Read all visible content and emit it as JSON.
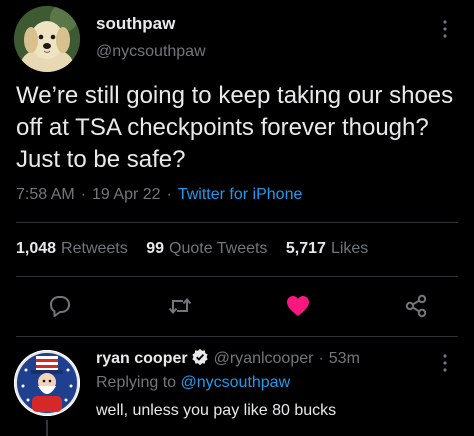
{
  "author": {
    "name": "southpaw",
    "handle": "@nycsouthpaw",
    "avatar": "golden-retriever-puppy"
  },
  "tweet": {
    "text": "We’re still going to keep taking our shoes off at TSA checkpoints forever though? Just to be safe?",
    "time": "7:58 AM",
    "date": "19 Apr 22",
    "source": "Twitter for iPhone"
  },
  "stats": {
    "retweets_count": "1,048",
    "retweets_label": "Retweets",
    "quotes_count": "99",
    "quotes_label": "Quote Tweets",
    "likes_count": "5,717",
    "likes_label": "Likes"
  },
  "actions": {
    "icons": [
      "reply-icon",
      "retweet-icon",
      "like-icon",
      "share-icon"
    ],
    "liked": true,
    "like_color": "#f91880"
  },
  "reply": {
    "name": "ryan cooper",
    "handle": "@ryanlcooper",
    "age": "53m",
    "replying_prefix": "Replying to",
    "replying_handle": "@nycsouthpaw",
    "text": "well, unless you pay like 80 bucks",
    "avatar": "uncle-sam-cartoon"
  },
  "colors": {
    "background": "#000000",
    "text": "#e7e9ea",
    "muted": "#71767b",
    "link": "#1d9bf0",
    "divider": "#2f3336"
  }
}
